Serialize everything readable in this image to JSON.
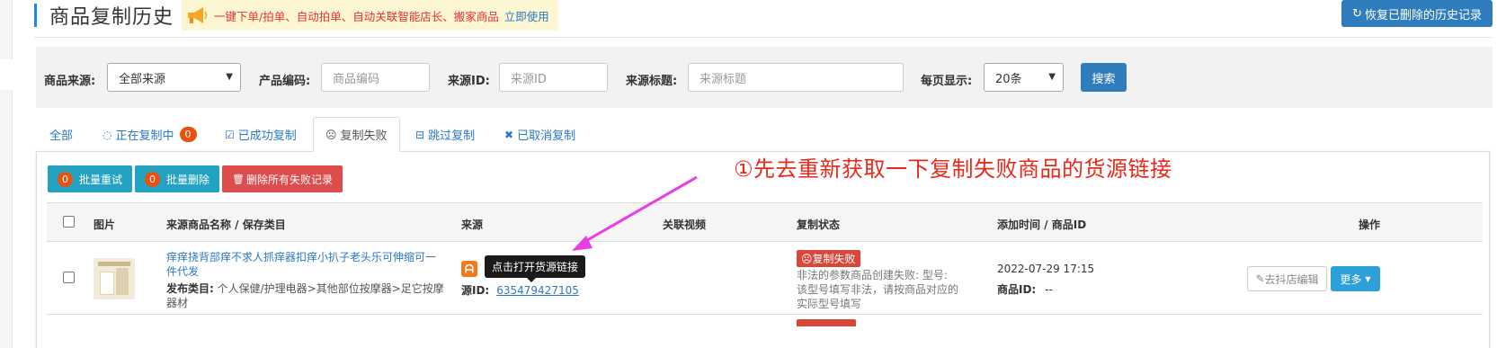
{
  "header": {
    "title": "商品复制历史",
    "promo_text": "一键下单/拍单、自动拍单、自动关联智能店长、搬家商品",
    "promo_link": "立即使用",
    "restore_label": "恢复已删除的历史记录"
  },
  "filters": {
    "source_label": "商品来源:",
    "source_value": "全部来源",
    "code_label": "产品编码:",
    "code_placeholder": "商品编码",
    "sourceid_label": "来源ID:",
    "sourceid_placeholder": "来源ID",
    "sourcetitle_label": "来源标题:",
    "sourcetitle_placeholder": "来源标题",
    "perpage_label": "每页显示:",
    "perpage_value": "20条",
    "search_label": "搜索"
  },
  "tabs": [
    {
      "label": "全部",
      "icon": "none"
    },
    {
      "label": "正在复制中",
      "icon": "spinner-icon",
      "count": "0"
    },
    {
      "label": "已成功复制",
      "icon": "checkbox-icon"
    },
    {
      "label": "复制失败",
      "icon": "frown-icon",
      "active": true
    },
    {
      "label": "跳过复制",
      "icon": "minus-square-icon"
    },
    {
      "label": "已取消复制",
      "icon": "x-icon"
    }
  ],
  "actions": {
    "batch_retry_count": "0",
    "batch_retry_label": "批量重试",
    "batch_delete_count": "0",
    "batch_delete_label": "批量删除",
    "delete_all_label": "删除所有失败记录"
  },
  "annotation": "①先去重新获取一下复制失败商品的货源链接",
  "table": {
    "headers": {
      "image": "图片",
      "name": "来源商品名称 / 保存类目",
      "source": "来源",
      "video": "关联视频",
      "status": "复制状态",
      "time": "添加时间 / 商品ID",
      "ops": "操作"
    },
    "rows": [
      {
        "name": "痒痒挠背部痒不求人抓痒器扣痒小扒子老头乐可伸缩可一件代发",
        "category_label": "发布类目:",
        "category": "个人保健/护理电器>其他部位按摩器>足它按摩器材",
        "tooltip": "点击打开货源链接",
        "source_id_label": "源ID:",
        "source_id": "635479427105",
        "status": "复制失败",
        "status_msg": "非法的参数商品创建失败: 型号: 该型号填写非法，请按商品对应的实际型号填写",
        "added_time": "2022-07-29 17:15",
        "goods_id_label": "商品ID:",
        "goods_id": "--",
        "edit_label": "去抖店编辑",
        "more_label": "更多"
      }
    ]
  },
  "colors": {
    "primary": "#2f7dbd",
    "info": "#23a2c1",
    "danger": "#dd4d4d",
    "badge": "#e8520e",
    "annotation": "#e8291b",
    "arrow": "#e83ce8"
  }
}
